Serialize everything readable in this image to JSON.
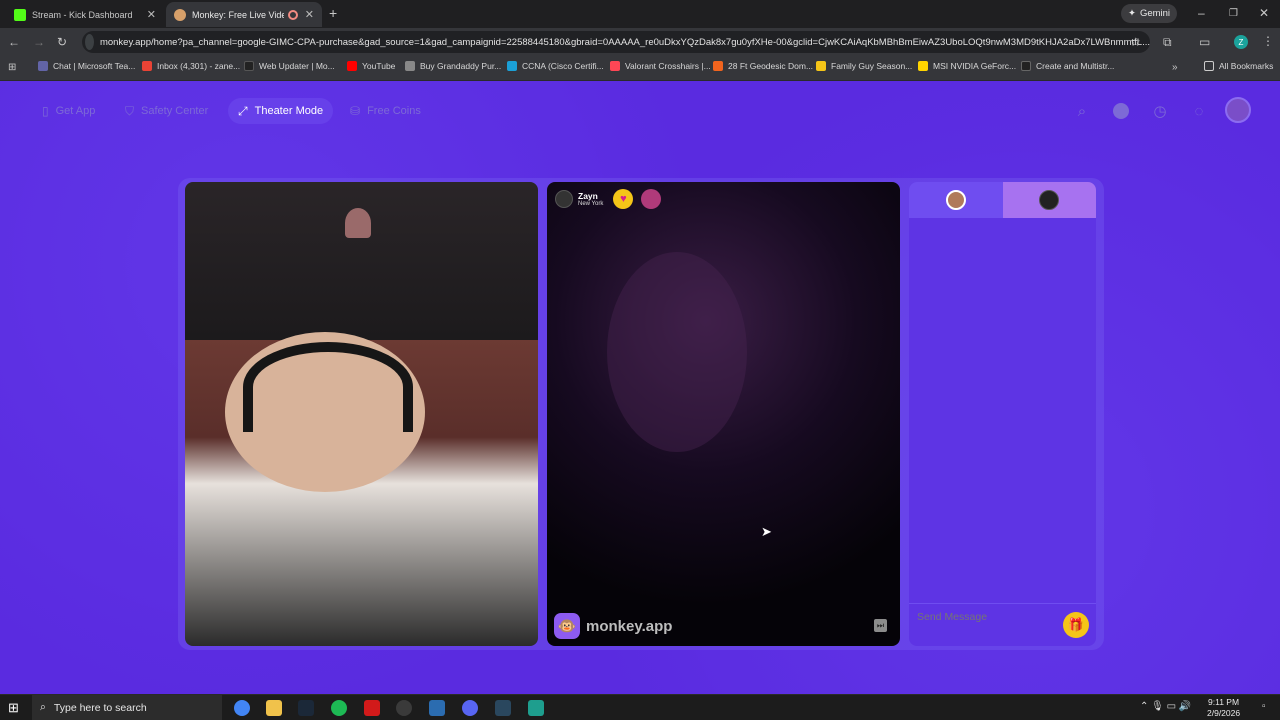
{
  "tabs": [
    {
      "label": "Stream - Kick Dashboard",
      "color": "#53fc18"
    },
    {
      "label": "Monkey: Free Live Video Ch",
      "color": "#d7a06a"
    }
  ],
  "gemini_label": "Gemini",
  "address": "monkey.app/home?pa_channel=google-GIMC-CPA-purchase&gad_source=1&gad_campaignid=22588445180&gbraid=0AAAAA_re0uDkxYQzDak8x7gu0yfXHe-00&gclid=CjwKCAiAqKbMBhBmEiwAZ3UboLOQt9nwM3MD9tKHJA2aDx7LWBnmmtfL...",
  "profile_initial": "Z",
  "bookmarks": [
    {
      "label": "Chat | Microsoft Tea...",
      "color": "#6264a7"
    },
    {
      "label": "Inbox (4,301) - zane...",
      "color": "#ea4335"
    },
    {
      "label": "Web Updater | Mo...",
      "color": "#222222"
    },
    {
      "label": "YouTube",
      "color": "#ff0000"
    },
    {
      "label": "Buy Grandaddy Pur...",
      "color": "#888888"
    },
    {
      "label": "CCNA (Cisco Certifi...",
      "color": "#1ba0d7"
    },
    {
      "label": "Valorant Crosshairs |...",
      "color": "#ff4655"
    },
    {
      "label": "28 Ft Geodesic Dom...",
      "color": "#f1641e"
    },
    {
      "label": "Family Guy Season...",
      "color": "#f5c518"
    },
    {
      "label": "MSI NVIDIA GeForc...",
      "color": "#ffd400"
    },
    {
      "label": "Create and Multistr...",
      "color": "#222222"
    }
  ],
  "all_bookmarks": "All Bookmarks",
  "nav": {
    "get_app": "Get App",
    "safety": "Safety Center",
    "theater": "Theater Mode",
    "coins": "Free Coins"
  },
  "partner": {
    "name": "Zayn",
    "location": "New York"
  },
  "watermark": "monkey.app",
  "chat": {
    "placeholder": "Send Message"
  },
  "taskbar": {
    "search": "Type here to search",
    "time": "9:11 PM",
    "date": "2/9/2026"
  },
  "colors": {
    "page_bg": "#5a2be0",
    "accent": "#6740ea",
    "gift": "#f5c518"
  }
}
